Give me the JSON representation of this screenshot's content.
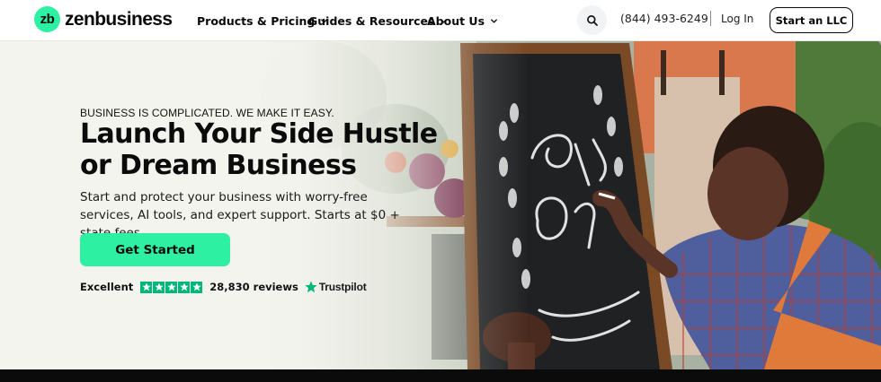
{
  "brand": {
    "mark_text": "zb",
    "name": "zenbusiness",
    "accent_color": "#2ef0a3"
  },
  "nav": {
    "items": [
      {
        "label": "Products & Pricing",
        "icon": "chevron-down-icon"
      },
      {
        "label": "Guides & Resources",
        "icon": "chevron-down-icon"
      },
      {
        "label": "About Us",
        "icon": "chevron-down-icon"
      }
    ]
  },
  "header": {
    "search_icon": "search-icon",
    "phone": "(844) 493-6249",
    "separator": "|",
    "login_label": "Log In",
    "cta_label": "Start an LLC"
  },
  "hero": {
    "eyebrow": "BUSINESS IS COMPLICATED. WE MAKE IT EASY.",
    "headline_line1": "Launch Your Side Hustle",
    "headline_line2": "or Dream Business",
    "subtext": "Start and protect your business with worry-free services, AI tools, and expert support. Starts at $0 + state fees.",
    "cta_label": "Get Started",
    "image_alt": "Man writing Grand Opening Welcome on a chalkboard sign"
  },
  "rating": {
    "label": "Excellent",
    "stars": 5,
    "star_color": "#00b67a",
    "reviews": "28,830 reviews",
    "provider": "Trustpilot"
  }
}
